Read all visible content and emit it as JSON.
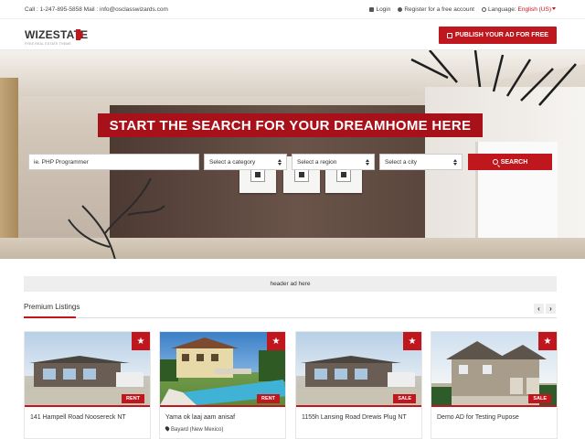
{
  "topbar": {
    "contact": "Call : 1-247-895-5858 Mail : info@osclasswizards.com",
    "login": "Login",
    "register": "Register for a free account",
    "language_label": "Language:",
    "language_value": "English (US)"
  },
  "header": {
    "logo_text": "WIZESTATE",
    "logo_tagline": "FREE REAL ESTATE THEME",
    "publish_label": "PUBLISH YOUR AD FOR FREE"
  },
  "hero": {
    "title": "START THE SEARCH FOR YOUR DREAMHOME HERE",
    "search_value": "ie. PHP Programmer",
    "category_select": "Select a category",
    "region_select": "Select a region",
    "city_select": "Select a city",
    "search_button": "SEARCH"
  },
  "ad": {
    "text": "header ad here"
  },
  "premium": {
    "title": "Premium Listings",
    "prev": "‹",
    "next": "›",
    "listings": [
      {
        "title": "141 Hampell Road Noosereck NT",
        "location": "",
        "badge": "RENT"
      },
      {
        "title": "Yama ok laaj aam anisaf",
        "location": "Bayard (New Mexico)",
        "badge": "RENT"
      },
      {
        "title": "1155h Lansing Road Drewis Plug NT",
        "location": "",
        "badge": "SALE"
      },
      {
        "title": "Demo AD for Testing Pupose",
        "location": "",
        "badge": "SALE"
      }
    ]
  },
  "colors": {
    "accent": "#c0161d",
    "hero_banner": "#a8101a"
  },
  "icons": {
    "login": "lock-icon",
    "register": "user-icon",
    "language": "globe-icon",
    "publish": "edit-icon",
    "search": "search-icon",
    "favorite": "star-icon",
    "location": "map-pin-icon"
  }
}
